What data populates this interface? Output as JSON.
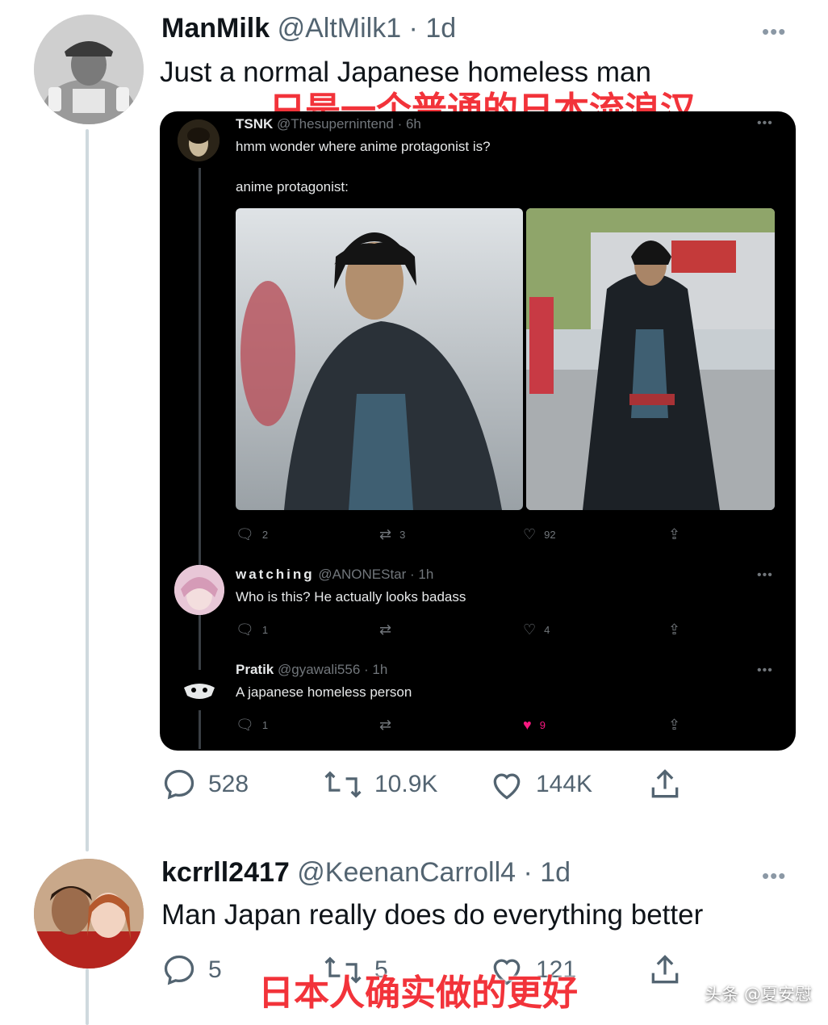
{
  "tweet1": {
    "name": "ManMilk",
    "handle": "@AltMilk1 · 1d",
    "text": "Just a normal Japanese homeless man",
    "overlay_cn": "只是一个普通的日本流浪汉",
    "more": "•••",
    "stats": {
      "replies": "528",
      "retweets": "10.9K",
      "likes": "144K"
    }
  },
  "embedded": {
    "post": {
      "name": "TSNK",
      "handle": "@Thesupernintend · 6h",
      "line1": "hmm wonder where anime protagonist is?",
      "line2": "anime protagonist:",
      "replies": "2",
      "retweets": "3",
      "likes": "92"
    },
    "reply1": {
      "name": "watching",
      "handle": "@ANONEStar · 1h",
      "text": "Who is this? He actually looks badass",
      "replies": "1",
      "retweets": "",
      "likes": "4"
    },
    "reply2": {
      "name": "Pratik",
      "handle": "@gyawali556 · 1h",
      "text": "A japanese homeless person",
      "replies": "1",
      "retweets": "",
      "likes": "9"
    },
    "more": "•••"
  },
  "tweet2": {
    "name": "kcrrll2417",
    "handle": "@KeenanCarroll4 · 1d",
    "text": "Man Japan really does do everything better",
    "overlay_cn": "日本人确实做的更好",
    "more": "•••",
    "stats": {
      "replies": "5",
      "retweets": "5",
      "likes": "121"
    }
  },
  "watermark": "头条 @夏安慰",
  "colors": {
    "like_active": "#f91880",
    "overlay_red": "#f2333a",
    "icon_gray": "#536471"
  },
  "icons": [
    "reply-icon",
    "retweet-icon",
    "like-icon",
    "share-icon",
    "more-icon"
  ]
}
